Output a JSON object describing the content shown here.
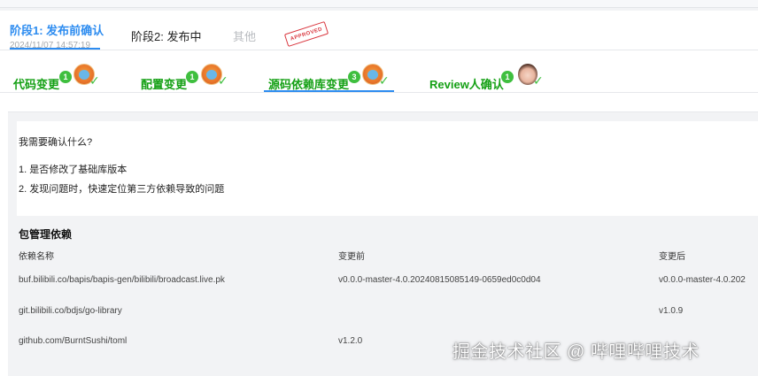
{
  "stages": [
    {
      "label": "阶段1: 发布前确认",
      "time": "2024/11/07 14:57:19",
      "active": true
    },
    {
      "label": "阶段2: 发布中",
      "active": false
    },
    {
      "label": "其他",
      "active": false,
      "disabled": true
    }
  ],
  "stamp": "APPROVED",
  "subtabs": [
    {
      "label": "代码变更",
      "count": "1",
      "avatar": "robot-avatar"
    },
    {
      "label": "配置变更",
      "count": "1",
      "avatar": "robot-avatar"
    },
    {
      "label": "源码依赖库变更",
      "count": "3",
      "avatar": "robot-avatar",
      "active": true
    },
    {
      "label": "Review人确认",
      "count": "1",
      "avatar": "user-avatar"
    }
  ],
  "intro": {
    "title": "我需要确认什么?",
    "lines": [
      "1. 是否修改了基础库版本",
      "2. 发现问题时，快速定位第三方依赖导致的问题"
    ]
  },
  "deps": {
    "title": "包管理依赖",
    "headers": [
      "依赖名称",
      "变更前",
      "变更后"
    ],
    "rows": [
      [
        "buf.bilibili.co/bapis/bapis-gen/bilibili/broadcast.live.pk",
        "v0.0.0-master-4.0.20240815085149-0659ed0c0d04",
        "v0.0.0-master-4.0.202"
      ],
      [
        "git.bilibili.co/bdjs/go-library",
        "",
        "v1.0.9"
      ],
      [
        "github.com/BurntSushi/toml",
        "v1.2.0",
        ""
      ]
    ]
  },
  "watermark": "掘金技术社区 @ 哔哩哔哩技术",
  "colors": {
    "accent": "#2d8cf0",
    "success": "#14a014",
    "badge": "#3fbf3f",
    "stamp": "#d9363e"
  }
}
